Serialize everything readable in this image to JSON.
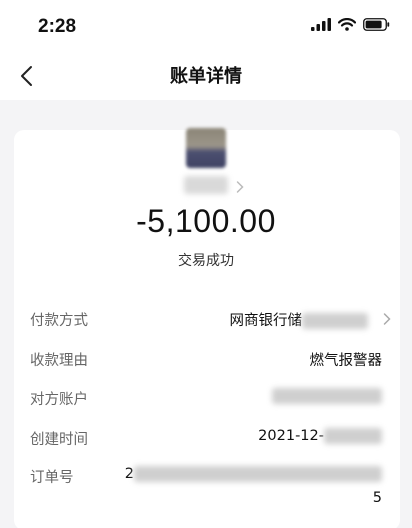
{
  "status_bar": {
    "time": "2:28"
  },
  "nav": {
    "title": "账单详情"
  },
  "transaction": {
    "amount": "-5,100.00",
    "status": "交易成功"
  },
  "details": [
    {
      "label": "付款方式",
      "value": "网商银行储"
    },
    {
      "label": "收款理由",
      "value": "燃气报警器"
    },
    {
      "label": "对方账户",
      "value": ""
    },
    {
      "label": "创建时间",
      "value": "2021-12-"
    },
    {
      "label": "订单号",
      "value": "2"
    }
  ],
  "order_number_suffix": "5",
  "colors": {
    "background": "#f4f4f6",
    "card": "#ffffff",
    "label": "#666666",
    "value": "#111111"
  }
}
